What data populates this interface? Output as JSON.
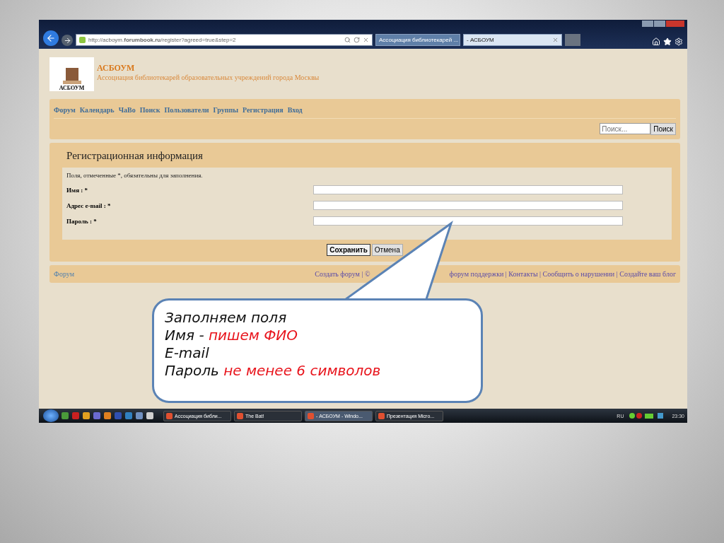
{
  "browser": {
    "address": "http://acboym.**forumbook.ru**/register?agreed=true&step=2",
    "tabs": [
      {
        "label": "Ассоциация библиотекарей ...",
        "selected": false
      },
      {
        "label": "- АСБОУМ",
        "selected": true
      }
    ]
  },
  "site": {
    "logo_caption": "АСБОУМ",
    "title": "АСБОУМ",
    "subtitle": "Ассоциация библиотекарей образовательных учреждений города Москвы",
    "nav": [
      "Форум",
      "Календарь",
      "ЧаВо",
      "Поиск",
      "Пользователи",
      "Группы",
      "Регистрация",
      "Вход"
    ],
    "search": {
      "placeholder": "Поиск...",
      "button": "Поиск"
    }
  },
  "form": {
    "title": "Регистрационная информация",
    "note": "Поля, отмеченные *, обязательны для заполнения.",
    "fields": [
      {
        "label": "Имя : *"
      },
      {
        "label": "Адрес e-mail : *"
      },
      {
        "label": "Пароль : *"
      }
    ],
    "buttons": [
      {
        "label": "Сохранить",
        "kind": "primary"
      },
      {
        "label": "Отмена",
        "kind": "secondary"
      }
    ]
  },
  "footer": {
    "left": "Форум",
    "links_before": "Создать форум | ©",
    "links_after": "форум поддержки | Контакты | Сообщить о нарушении | Создайте ваш блог"
  },
  "callout": {
    "lines": [
      {
        "lead": "Заполняем поля"
      },
      {
        "lead": "Имя  - ",
        "note": "пишем ФИО"
      },
      {
        "lead": "E-mail"
      },
      {
        "lead": "Пароль ",
        "note": "не менее 6 символов"
      }
    ]
  },
  "taskbar": {
    "tasks": [
      {
        "label": "Ассоциация библи...",
        "selected": false
      },
      {
        "label": "The Bat!",
        "selected": false
      },
      {
        "label": "- АСБОУМ - Windo...",
        "selected": true
      },
      {
        "label": "Презентация Micro...",
        "selected": false
      }
    ],
    "language": "RU",
    "time": "23:30"
  }
}
